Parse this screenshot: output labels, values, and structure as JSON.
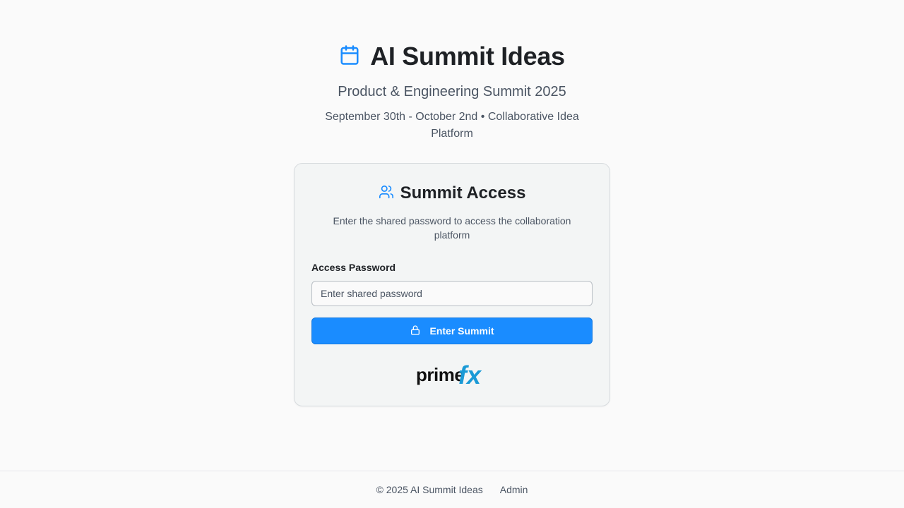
{
  "header": {
    "title": "AI Summit Ideas",
    "subtitle": "Product & Engineering Summit 2025",
    "tagline": "September 30th - October 2nd • Collaborative Idea Platform",
    "icon": "calendar-icon"
  },
  "card": {
    "icon": "users-icon",
    "title": "Summit Access",
    "description": "Enter the shared password to access the collaboration platform",
    "password_label": "Access Password",
    "password_placeholder": "Enter shared password",
    "password_value": "",
    "submit_label": "Enter Summit",
    "submit_icon": "lock-icon",
    "logo_text": "primefx"
  },
  "footer": {
    "copyright": "© 2025 AI Summit Ideas",
    "admin_link": "Admin"
  },
  "colors": {
    "accent": "#1a8cff",
    "logo_blue": "#1a9ad6",
    "text_dark": "#1e2125",
    "text_muted": "#4b5563"
  }
}
